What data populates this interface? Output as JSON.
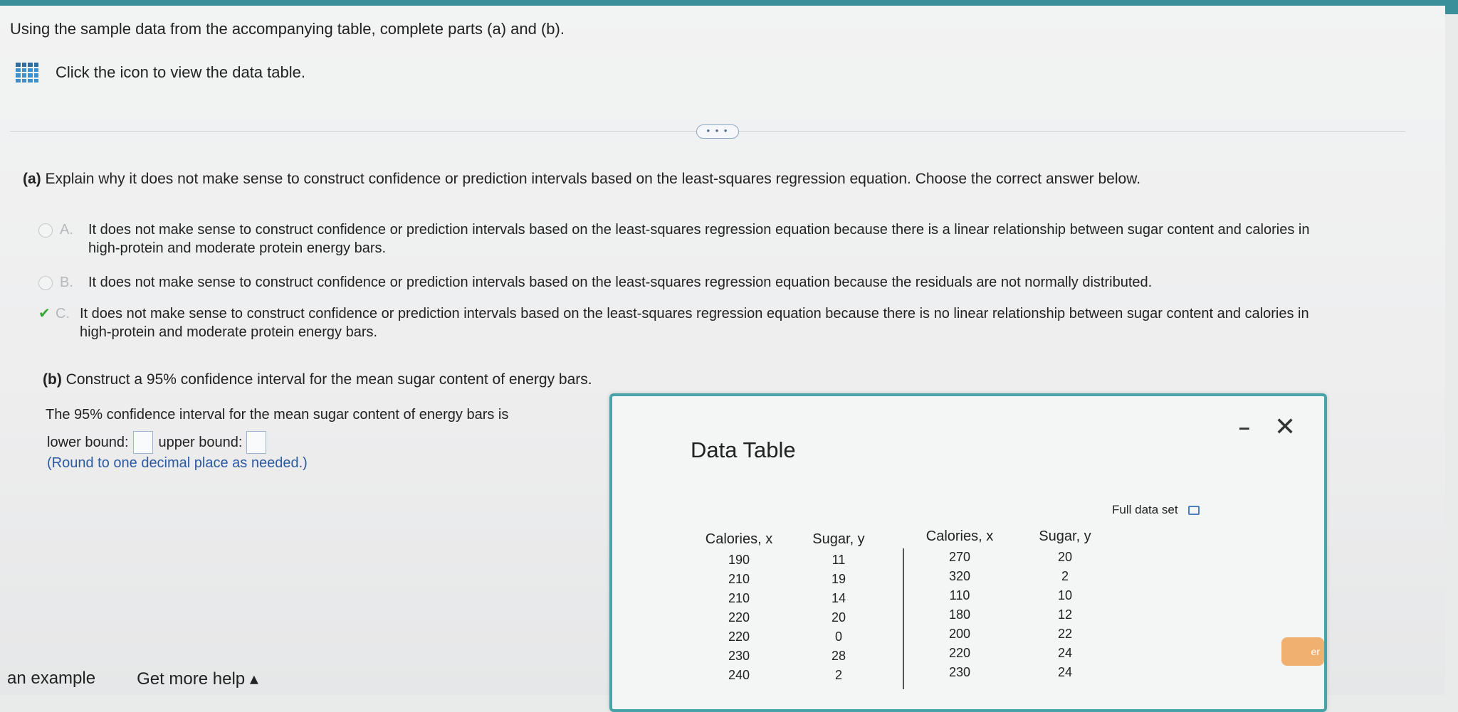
{
  "question": {
    "title": "Using the sample data from the accompanying table, complete parts (a) and (b).",
    "icon_hint": "Click the icon to view the data table.",
    "more_label": "• • •"
  },
  "part_a": {
    "label": "(a)",
    "text": "Explain why it does not make sense to construct confidence or prediction intervals based on the least-squares regression equation. Choose the correct answer below.",
    "choices": [
      {
        "letter": "A.",
        "text": "It does not make sense to construct confidence or prediction intervals based on the least-squares regression equation because there is a linear relationship between sugar content and calories in high-protein and moderate protein energy bars.",
        "selected": false
      },
      {
        "letter": "B.",
        "text": "It does not make sense to construct confidence or prediction intervals based on the least-squares regression equation because the residuals are not normally distributed.",
        "selected": false
      },
      {
        "letter": "C.",
        "text": "It does not make sense to construct confidence or prediction intervals based on the least-squares regression equation because there is no linear relationship between sugar content and calories in high-protein and moderate protein energy bars.",
        "selected": true
      }
    ],
    "check_mark": "✔"
  },
  "part_b": {
    "label": "(b)",
    "text": "Construct a 95% confidence interval for the mean sugar content of energy bars.",
    "ci_sentence": "The 95% confidence interval for the mean sugar content of energy bars is",
    "lower_label": "lower bound:",
    "upper_label": "upper bound:",
    "lower_value": "",
    "upper_value": "",
    "round_note": "(Round to one decimal place as needed.)"
  },
  "footer": {
    "example": "an example",
    "help": "Get more help ▴",
    "orange_button_partial": "er"
  },
  "data_table": {
    "title": "Data Table",
    "minimize": "–",
    "close": "✕",
    "full_data_set": "Full data set",
    "headers": [
      "Calories, x",
      "Sugar, y",
      "Calories, x",
      "Sugar, y"
    ],
    "left_calories": [
      "190",
      "210",
      "210",
      "220",
      "220",
      "230",
      "240"
    ],
    "left_sugar": [
      "11",
      "19",
      "14",
      "20",
      "0",
      "28",
      "2"
    ],
    "right_calories": [
      "270",
      "320",
      "110",
      "180",
      "200",
      "220",
      "230"
    ],
    "right_sugar": [
      "20",
      "2",
      "10",
      "12",
      "22",
      "24",
      "24"
    ]
  },
  "colors": {
    "accent_teal": "#48a3a8",
    "link_blue": "#2c5aa0",
    "check_green": "#3aa637",
    "icon_blue": "#3f8fc9"
  }
}
